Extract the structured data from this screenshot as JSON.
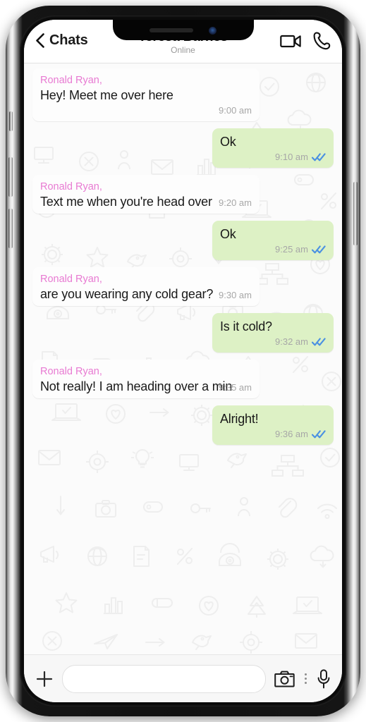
{
  "device": {
    "notch": {
      "speaker_icon": "speaker-grille",
      "camera_icon": "front-camera"
    },
    "buttons": {
      "silent_switch": "silent-switch",
      "volume_up": "volume-up-button",
      "volume_down": "volume-down-button",
      "power": "power-button"
    }
  },
  "header": {
    "back_label": "Chats",
    "back_icon": "chevron-left-icon",
    "contact_name": "Teresa Barnes",
    "status": "Online",
    "video_call_icon": "video-camera-icon",
    "voice_call_icon": "phone-handset-icon"
  },
  "colors": {
    "incoming_bubble": "#fdfdfd",
    "outgoing_bubble": "#ddf1c5",
    "sender_name": "#e87ad2",
    "message_text": "#191919",
    "timestamp": "#a7a7a7",
    "tick_read": "#4a90e2",
    "header_bg": "#ffffff",
    "input_bar_bg": "#f7f7f7"
  },
  "messages": [
    {
      "direction": "incoming",
      "sender": "Ronald Ryan,",
      "text": "Hey! Meet me over here",
      "time": "9:00 am",
      "status": "none",
      "inline_meta": false
    },
    {
      "direction": "outgoing",
      "sender": "",
      "text": "Ok",
      "time": "9:10 am",
      "status": "read",
      "inline_meta": false
    },
    {
      "direction": "incoming",
      "sender": "Ronald Ryan,",
      "text": "Text me when you're head over",
      "time": "9:20 am",
      "status": "none",
      "inline_meta": true
    },
    {
      "direction": "outgoing",
      "sender": "",
      "text": "Ok",
      "time": "9:25 am",
      "status": "read",
      "inline_meta": false
    },
    {
      "direction": "incoming",
      "sender": "Ronald Ryan,",
      "text": "are you wearing any cold gear?",
      "time": "9:30 am",
      "status": "none",
      "inline_meta": true
    },
    {
      "direction": "outgoing",
      "sender": "",
      "text": "Is it cold?",
      "time": "9:32 am",
      "status": "read",
      "inline_meta": false
    },
    {
      "direction": "incoming",
      "sender": "Ronald Ryan,",
      "text": "Not really! I am heading over a min",
      "time": "9:35 am",
      "status": "none",
      "inline_meta": true
    },
    {
      "direction": "outgoing",
      "sender": "",
      "text": "Alright!",
      "time": "9:36 am",
      "status": "read",
      "inline_meta": false
    }
  ],
  "input_bar": {
    "add_icon": "plus-icon",
    "input_value": "",
    "input_placeholder": "",
    "camera_icon": "camera-icon",
    "more_icon": "vertical-dots-icon",
    "mic_icon": "microphone-icon"
  }
}
